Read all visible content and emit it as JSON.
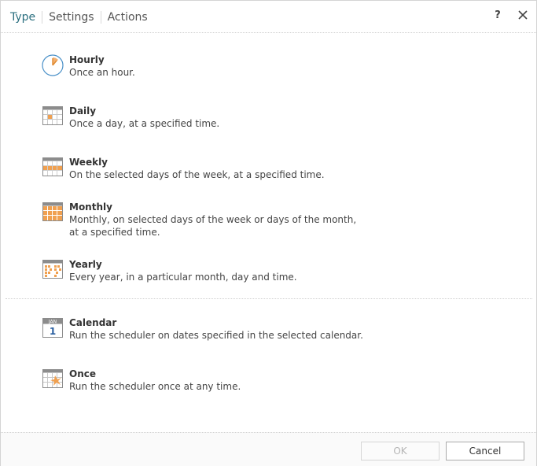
{
  "tabs": [
    {
      "label": "Type",
      "active": true
    },
    {
      "label": "Settings",
      "active": false
    },
    {
      "label": "Actions",
      "active": false
    }
  ],
  "header": {
    "help_label": "?"
  },
  "options": [
    {
      "title": "Hourly",
      "description": "Once an hour.",
      "icon": "clock-icon"
    },
    {
      "title": "Daily",
      "description": "Once a day, at a specified time.",
      "icon": "calendar-daily-icon"
    },
    {
      "title": "Weekly",
      "description": "On the selected days of the week, at a specified time.",
      "icon": "calendar-weekly-icon"
    },
    {
      "title": "Monthly",
      "description": "Monthly, on selected days of the week or days of the month, at a specified time.",
      "icon": "calendar-monthly-icon"
    },
    {
      "title": "Yearly",
      "description": "Every year, in a particular month, day and time.",
      "icon": "calendar-yearly-icon"
    },
    {
      "title": "Calendar",
      "description": "Run the scheduler on dates specified in the selected calendar.",
      "icon": "calendar-page-icon",
      "icon_text": {
        "month": "JAN",
        "day": "1"
      }
    },
    {
      "title": "Once",
      "description": "Run the scheduler once at any time.",
      "icon": "calendar-once-icon"
    }
  ],
  "footer": {
    "ok_label": "OK",
    "ok_enabled": false,
    "cancel_label": "Cancel"
  },
  "colors": {
    "accent": "#2a6f7f",
    "icon_orange": "#f0a050",
    "icon_gray": "#8c8c8c",
    "clock_blue": "#4a90c8"
  }
}
